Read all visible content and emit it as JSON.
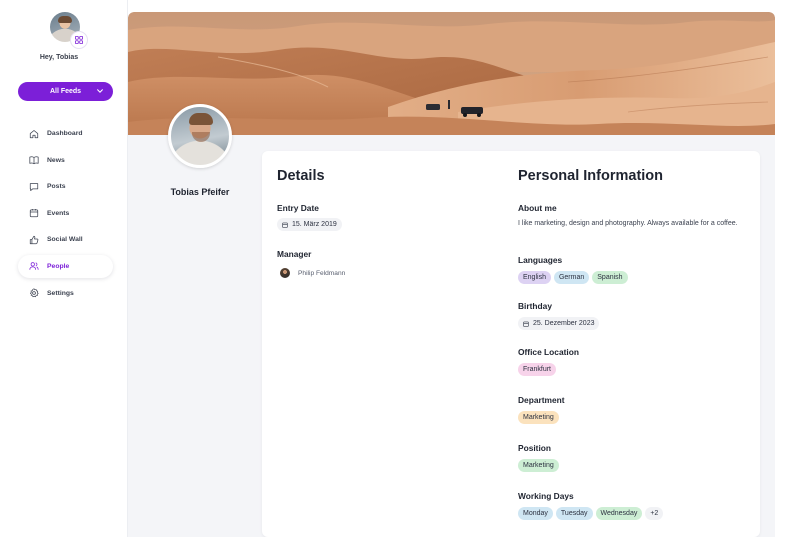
{
  "user": {
    "greeting": "Hey, Tobias"
  },
  "sidebar": {
    "feeds_button": "All Feeds",
    "items": [
      {
        "label": "Dashboard",
        "icon": "home-icon",
        "active": false
      },
      {
        "label": "News",
        "icon": "book-icon",
        "active": false
      },
      {
        "label": "Posts",
        "icon": "chat-bubble-icon",
        "active": false
      },
      {
        "label": "Events",
        "icon": "calendar-icon",
        "active": false
      },
      {
        "label": "Social Wall",
        "icon": "thumbs-up-icon",
        "active": false
      },
      {
        "label": "People",
        "icon": "people-icon",
        "active": true
      },
      {
        "label": "Settings",
        "icon": "gear-icon",
        "active": false
      }
    ]
  },
  "profile": {
    "name": "Tobias Pfeifer"
  },
  "details": {
    "title": "Details",
    "entry_date_label": "Entry Date",
    "entry_date": "15. März 2019",
    "manager_label": "Manager",
    "manager_name": "Philip Feldmann"
  },
  "personal": {
    "title": "Personal Information",
    "about_label": "About me",
    "about_text": "I like marketing, design and photography. Always available for a coffee.",
    "languages_label": "Languages",
    "languages": [
      "English",
      "German",
      "Spanish"
    ],
    "birthday_label": "Birthday",
    "birthday": "25. Dezember 2023",
    "office_label": "Office Location",
    "office": "Frankfurt",
    "department_label": "Department",
    "department": "Marketing",
    "position_label": "Position",
    "position": "Marketing",
    "working_days_label": "Working Days",
    "working_days": [
      "Monday",
      "Tuesday",
      "Wednesday"
    ],
    "working_days_more": "+2"
  },
  "colors": {
    "accent": "#7c1fd8",
    "pill_purple": "#ddd2f3",
    "pill_blue": "#cfe6f3",
    "pill_green": "#cdeed4",
    "pill_pink": "#f7d3ea",
    "pill_orange": "#fbe2bd",
    "pill_gray": "#f1f2f5"
  }
}
